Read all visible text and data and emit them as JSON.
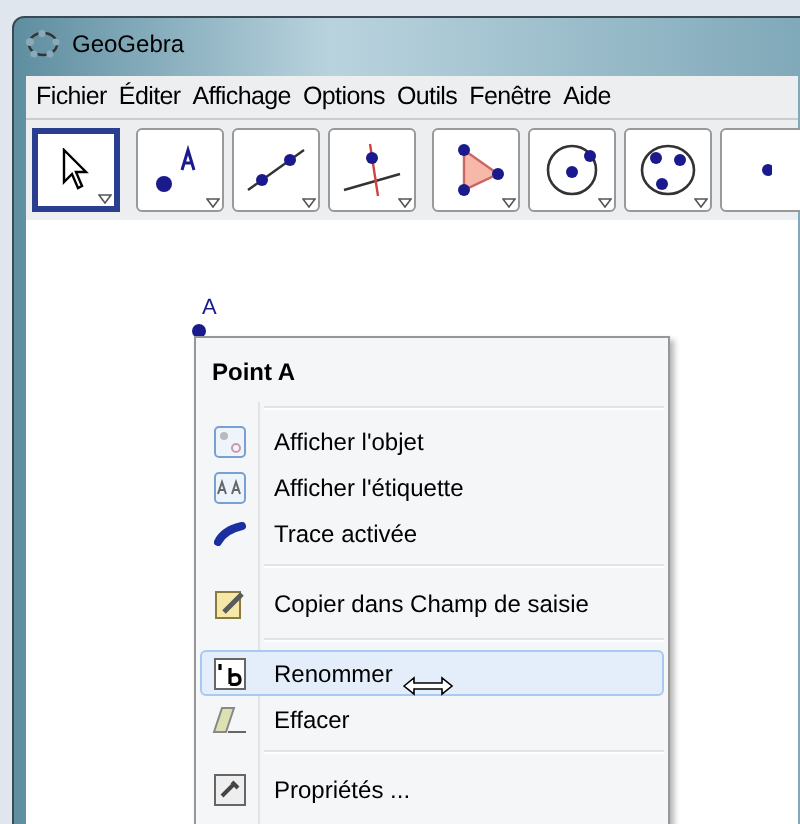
{
  "window": {
    "title": "GeoGebra"
  },
  "menu_bar": [
    "Fichier",
    "Éditer",
    "Affichage",
    "Options",
    "Outils",
    "Fenêtre",
    "Aide"
  ],
  "toolbar": [
    {
      "kind": "pointer",
      "selected": true
    },
    {
      "kind": "point",
      "selected": false
    },
    {
      "kind": "line",
      "selected": false
    },
    {
      "kind": "perpendicular",
      "selected": false
    },
    {
      "kind": "polygon",
      "selected": false
    },
    {
      "kind": "circle",
      "selected": false
    },
    {
      "kind": "conic",
      "selected": false
    },
    {
      "kind": "partial",
      "selected": false
    }
  ],
  "canvas": {
    "point_label": "A"
  },
  "context_menu": {
    "title": "Point A",
    "groups": [
      [
        {
          "kind": "show-object",
          "label": "Afficher l'objet",
          "selected": false
        },
        {
          "kind": "show-label",
          "label": "Afficher l'étiquette",
          "selected": false
        },
        {
          "kind": "trace",
          "label": "Trace activée",
          "selected": false
        }
      ],
      [
        {
          "kind": "copy",
          "label": "Copier dans Champ de saisie",
          "selected": false
        }
      ],
      [
        {
          "kind": "rename",
          "label": "Renommer",
          "selected": true
        },
        {
          "kind": "delete",
          "label": "Effacer",
          "selected": false
        }
      ],
      [
        {
          "kind": "properties",
          "label": "Propriétés ...",
          "selected": false
        }
      ]
    ]
  }
}
